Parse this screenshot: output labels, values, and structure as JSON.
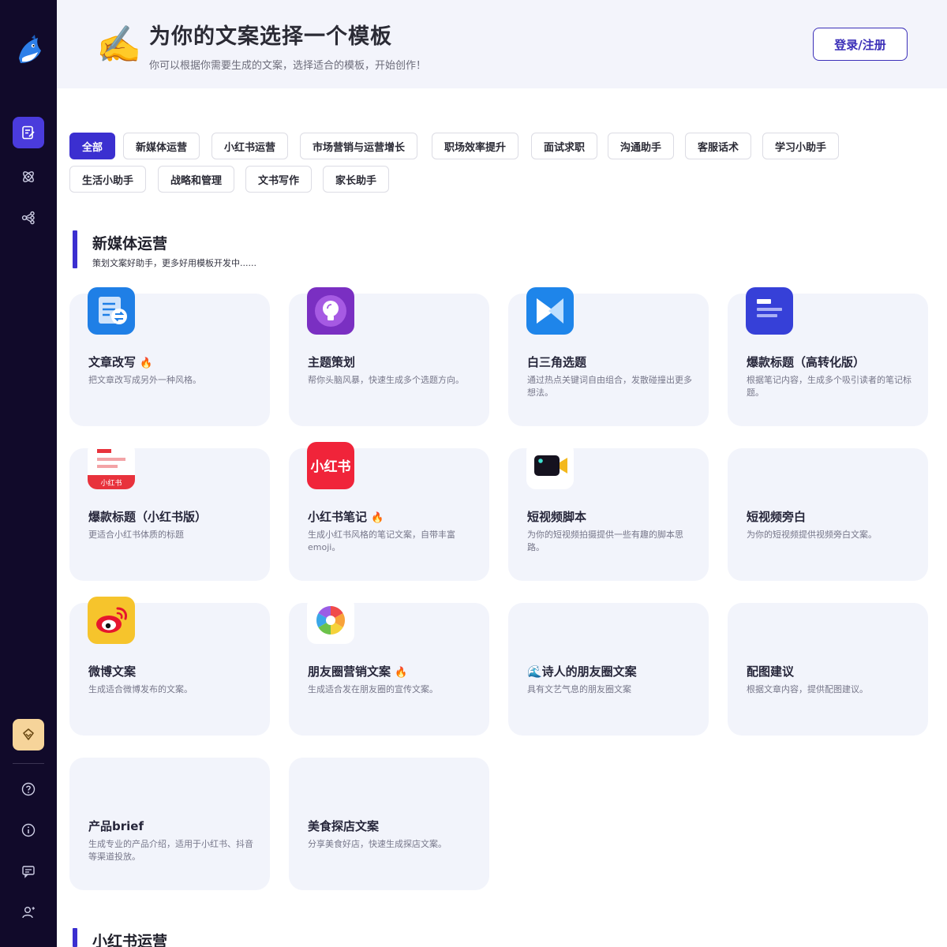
{
  "header": {
    "emoji": "✍️",
    "title": "为你的文案选择一个模板",
    "subtitle": "你可以根据你需要生成的文案，选择适合的模板，开始创作！",
    "login_label": "登录/注册"
  },
  "categories": [
    {
      "label": "全部",
      "active": true
    },
    {
      "label": "新媒体运营"
    },
    {
      "label": "小红书运营"
    },
    {
      "label": "市场营销与运营增长"
    },
    {
      "label": "职场效率提升"
    },
    {
      "label": "面试求职"
    },
    {
      "label": "沟通助手"
    },
    {
      "label": "客服话术"
    },
    {
      "label": "学习小助手"
    },
    {
      "label": "生活小助手"
    },
    {
      "label": "战略和管理"
    },
    {
      "label": "文书写作"
    },
    {
      "label": "家长助手"
    }
  ],
  "section": {
    "title": "新媒体运营",
    "desc": "策划文案好助手，更多好用模板开发中......"
  },
  "cards": [
    {
      "title": "文章改写",
      "hot": true,
      "desc": "把文章改写成另外一种风格。",
      "icon": "rewrite-icon"
    },
    {
      "title": "主题策划",
      "hot": false,
      "desc": "帮你头脑风暴，快速生成多个选题方向。",
      "icon": "lightbulb-icon"
    },
    {
      "title": "白三角选题",
      "hot": false,
      "desc": "通过热点关键词自由组合，发散碰撞出更多想法。",
      "icon": "triangle-icon"
    },
    {
      "title": "爆款标题（高转化版）",
      "hot": false,
      "desc": "根据笔记内容，生成多个吸引读者的笔记标题。",
      "icon": "headline-icon"
    },
    {
      "title": "爆款标题（小红书版）",
      "hot": false,
      "desc": "更适合小红书体质的标题",
      "icon": "xhs-headline-icon"
    },
    {
      "title": "小红书笔记",
      "hot": true,
      "desc": "生成小红书风格的笔记文案，自带丰富emoji。",
      "icon": "xiaohongshu-icon"
    },
    {
      "title": "短视频脚本",
      "hot": false,
      "desc": "为你的短视频拍摄提供一些有趣的脚本思路。",
      "icon": "video-camera-icon"
    },
    {
      "title": "短视频旁白",
      "hot": false,
      "desc": "为你的短视频提供视频旁白文案。",
      "icon": ""
    },
    {
      "title": "微博文案",
      "hot": false,
      "desc": "生成适合微博发布的文案。",
      "icon": "weibo-icon"
    },
    {
      "title": "朋友圈营销文案",
      "hot": true,
      "desc": "生成适合发在朋友圈的宣传文案。",
      "icon": "moments-icon"
    },
    {
      "title": "🌊诗人的朋友圈文案",
      "hot": false,
      "desc": "具有文艺气息的朋友圈文案",
      "icon": ""
    },
    {
      "title": "配图建议",
      "hot": false,
      "desc": "根据文章内容，提供配图建议。",
      "icon": ""
    },
    {
      "title": "产品brief",
      "hot": false,
      "desc": "生成专业的产品介绍，适用于小红书、抖音等渠道投放。",
      "icon": ""
    },
    {
      "title": "美食探店文案",
      "hot": false,
      "desc": "分享美食好店，快速生成探店文案。",
      "icon": ""
    }
  ],
  "next_section": {
    "title": "小红书运营"
  },
  "sidebar": {
    "nav": [
      "templates-icon",
      "atom-icon",
      "workflow-icon"
    ],
    "bottom": [
      "vip-icon",
      "help-icon",
      "info-icon",
      "feedback-icon",
      "user-add-icon"
    ]
  },
  "fire_emoji": "🔥",
  "colors": {
    "accent": "#3b2fd0",
    "sidebar": "#110a2a",
    "card_bg": "#f2f4fb",
    "vip": "#f6d49a"
  }
}
